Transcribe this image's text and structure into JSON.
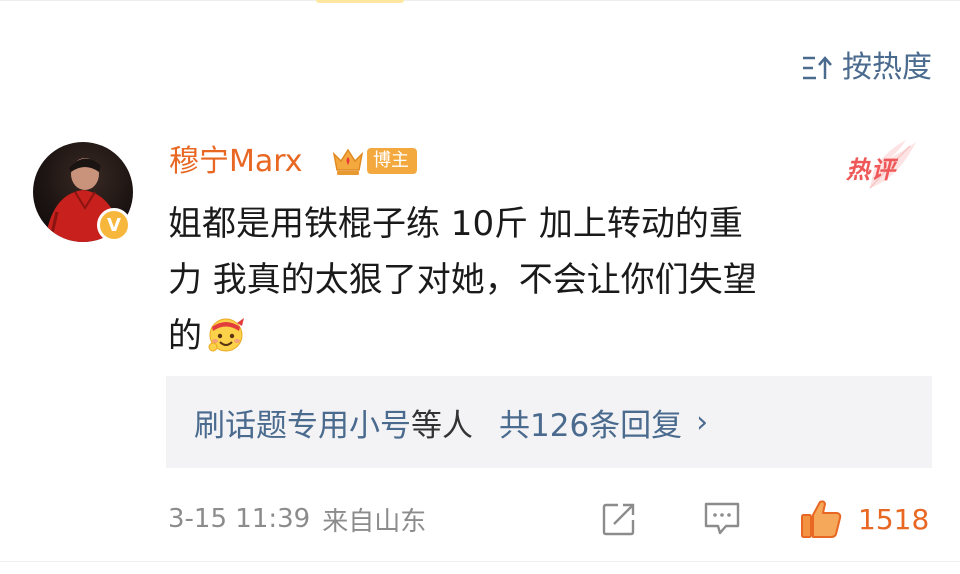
{
  "sort": {
    "label": "按热度",
    "icon": "sort-icon"
  },
  "comment": {
    "username": "穆宁Marx",
    "badge_label": "博主",
    "badge_level": "6",
    "hot_label": "热评",
    "text_line1": "姐都是用铁棍子练 10斤  加上转动的重",
    "text_line2": "力   我真的太狠了对她，不会让你们失望",
    "text_line3": "的",
    "emoji": "cheer-emoji"
  },
  "replies": {
    "names": "刷话题专用小号",
    "etc": "等人",
    "count_text": "共126条回复",
    "chevron": "›"
  },
  "footer": {
    "time": "3-15 11:39",
    "source": "来自山东",
    "like_count": "1518"
  },
  "colors": {
    "accent_orange": "#e86722",
    "link_blue": "#4a6a8e",
    "hot_red": "#ef5858",
    "badge_gold": "#f4a93f",
    "verify_gold": "#f6b73c"
  }
}
